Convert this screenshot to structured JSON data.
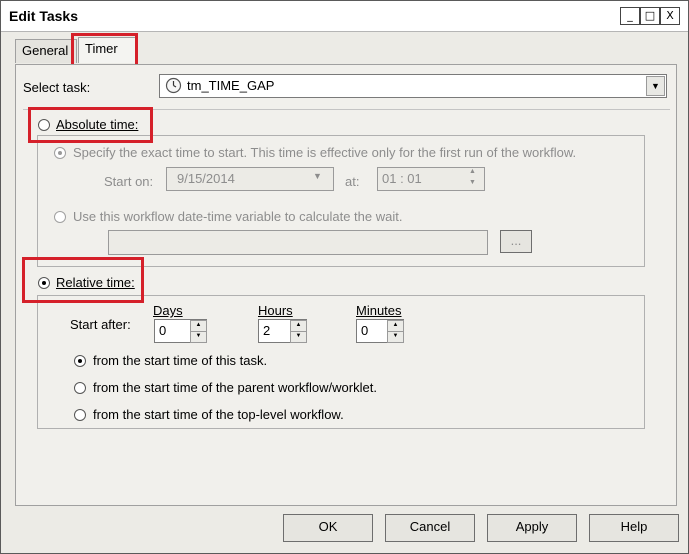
{
  "window": {
    "title": "Edit Tasks",
    "buttons": [
      "_",
      "□",
      "X"
    ]
  },
  "tabs": [
    "General",
    "Timer"
  ],
  "select_task": {
    "label": "Select task:",
    "value": "tm_TIME_GAP",
    "icon": "clock-icon"
  },
  "absolute": {
    "label": "Absolute time:",
    "option_exact": "Specify the exact time to start.  This time is effective only for the first run of the workflow.",
    "start_on_label": "Start on:",
    "start_on_value": "9/15/2014",
    "at_label": "at:",
    "at_value": "01 : 01",
    "option_variable": "Use this workflow date-time variable to calculate the wait.",
    "browse_label": "..."
  },
  "relative": {
    "label": "Relative time:",
    "start_after": "Start after:",
    "days_label": "Days",
    "days_value": "0",
    "hours_label": "Hours",
    "hours_value": "2",
    "minutes_label": "Minutes",
    "minutes_value": "0",
    "options": [
      "from the start time of this task.",
      "from the start time of the parent workflow/worklet.",
      "from the start time of the top-level workflow."
    ]
  },
  "footer": {
    "ok": "OK",
    "cancel": "Cancel",
    "apply": "Apply",
    "help": "Help"
  },
  "colors": {
    "highlight": "#d5202a"
  }
}
